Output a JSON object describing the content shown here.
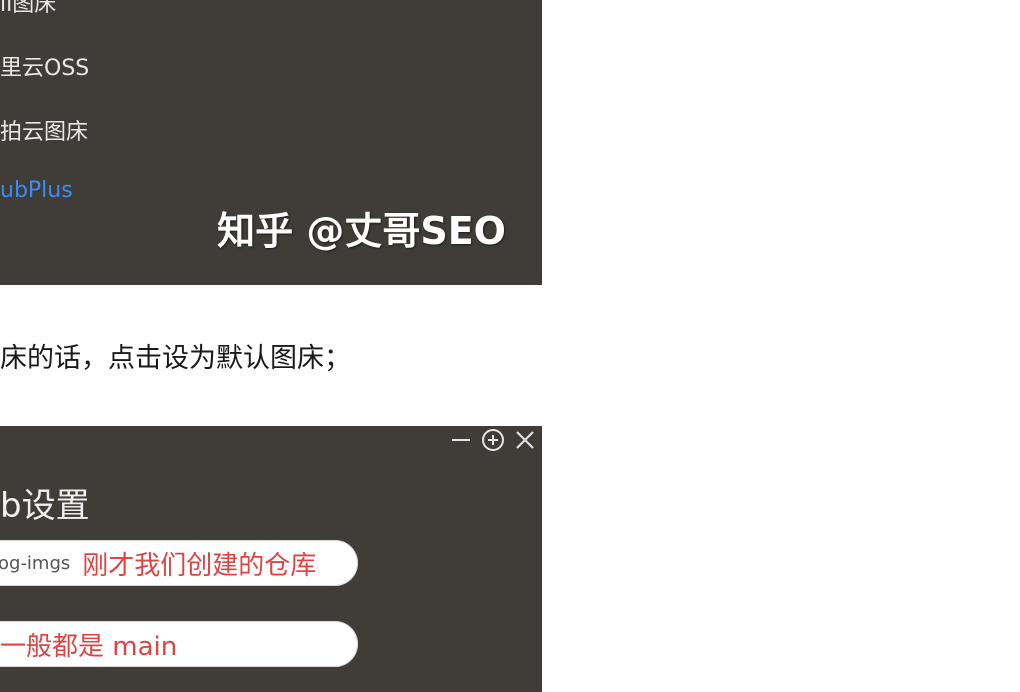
{
  "top_panel": {
    "menu_items": [
      {
        "label": "ıl图床"
      },
      {
        "label": "里云OSS"
      },
      {
        "label": "拍云图床"
      },
      {
        "label": "ubPlus"
      }
    ],
    "watermark": "知乎 @丈哥SEO"
  },
  "instruction_text": "床的话，点击设为默认图床；",
  "bottom_panel": {
    "title": "b设置",
    "window_controls": {
      "minimize_icon": "minus-icon",
      "pin_icon": "circle-plus-icon",
      "close_icon": "close-icon"
    },
    "repo_field": {
      "value": "og-imgs",
      "annotation": "刚才我们创建的仓库"
    },
    "branch_field": {
      "annotation": "一般都是 main"
    }
  },
  "colors": {
    "panel_bg": "#403d39",
    "active_menu": "#3d8bf2",
    "annotation_red": "#e04343"
  }
}
